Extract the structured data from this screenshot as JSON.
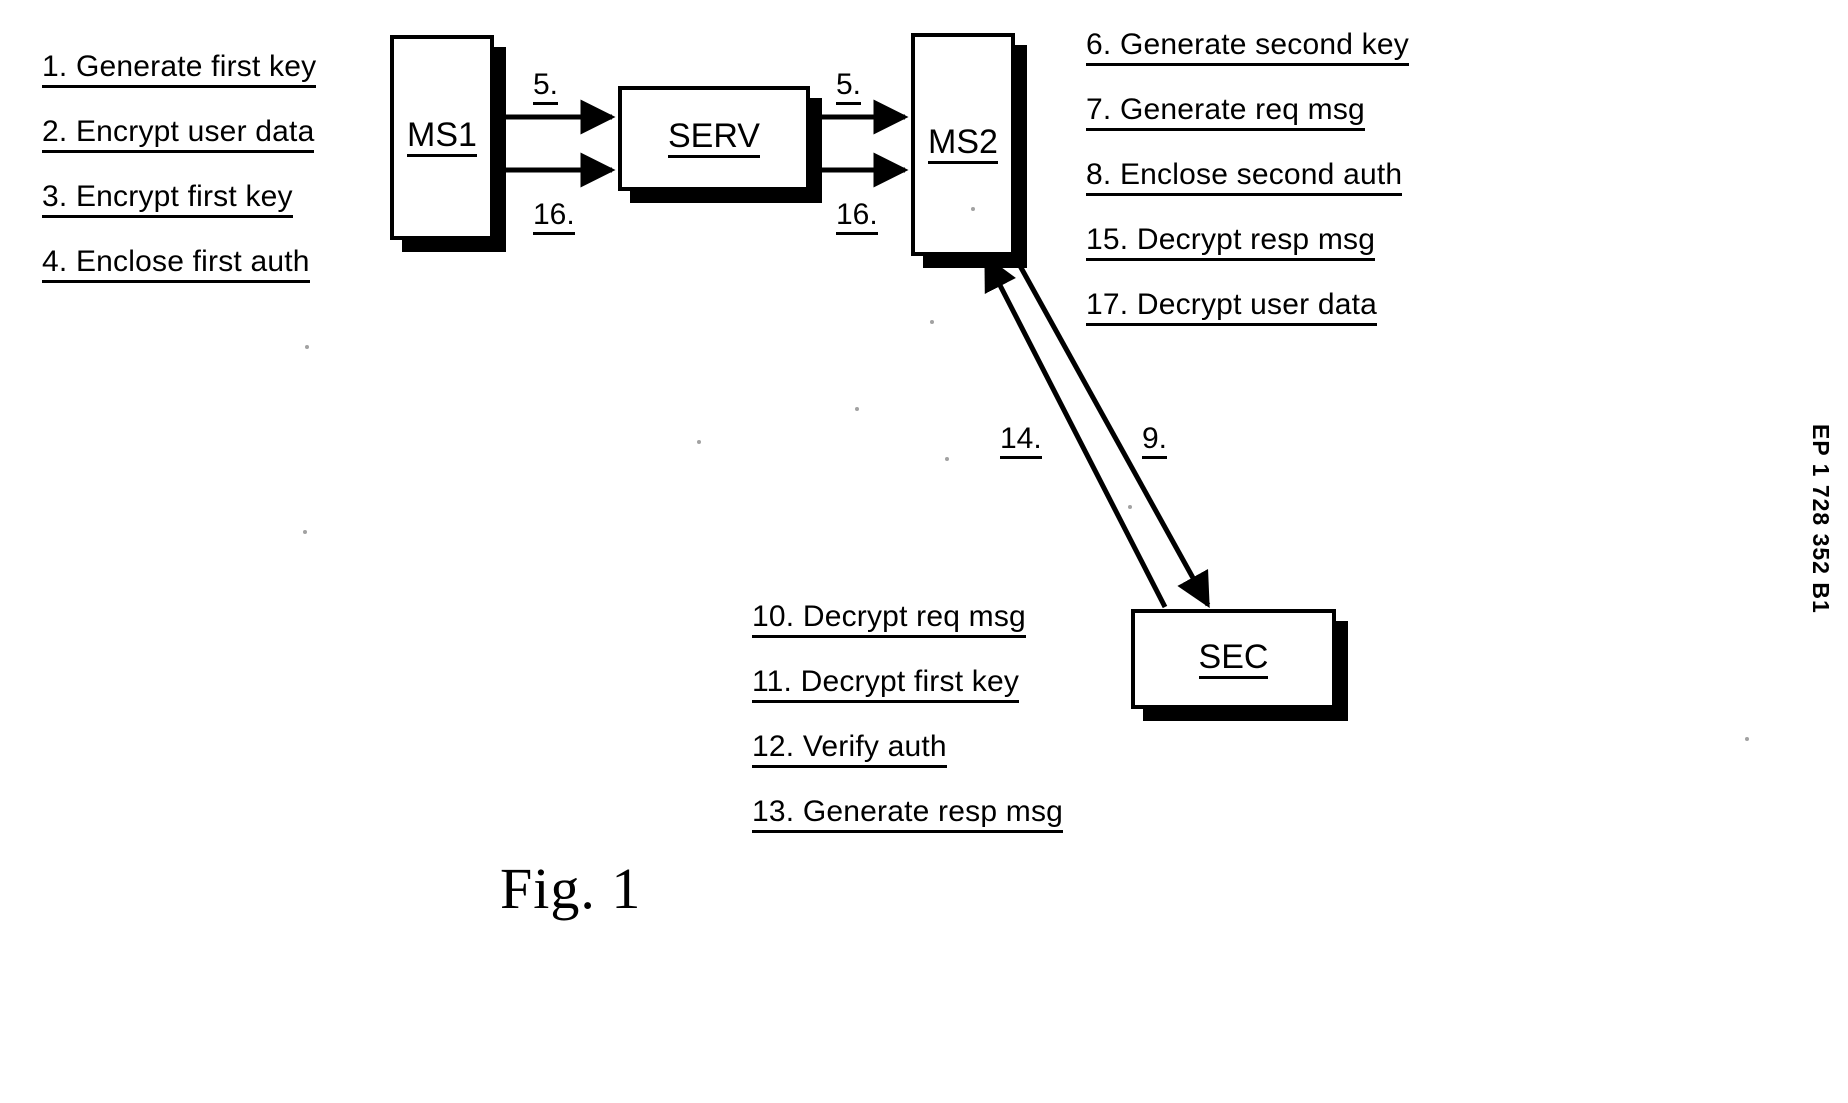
{
  "figure": {
    "caption": "Fig. 1",
    "patent_number": "EP 1 728 352 B1"
  },
  "nodes": [
    {
      "id": "ms1",
      "label": "MS1"
    },
    {
      "id": "serv",
      "label": "SERV"
    },
    {
      "id": "ms2",
      "label": "MS2"
    },
    {
      "id": "sec",
      "label": "SEC"
    }
  ],
  "connector_labels": [
    {
      "id": "ms1-serv-top",
      "text": "5."
    },
    {
      "id": "ms1-serv-bot",
      "text": "16."
    },
    {
      "id": "serv-ms2-top",
      "text": "5."
    },
    {
      "id": "serv-ms2-bot",
      "text": "16."
    },
    {
      "id": "sec-ms2-up",
      "text": "14."
    },
    {
      "id": "ms2-sec-down",
      "text": "9."
    }
  ],
  "steps": {
    "left": [
      "1. Generate first key",
      "2. Encrypt user data",
      "3. Encrypt first key",
      "4. Enclose first auth"
    ],
    "right": [
      "6. Generate second key",
      "7. Generate req msg",
      "8. Enclose second auth",
      "15. Decrypt resp msg",
      "17. Decrypt user data"
    ],
    "bottom": [
      "10. Decrypt req msg",
      "11. Decrypt first key",
      "12. Verify auth",
      "13. Generate resp msg"
    ]
  },
  "colors": {
    "ink": "#000000",
    "paper": "#ffffff"
  }
}
